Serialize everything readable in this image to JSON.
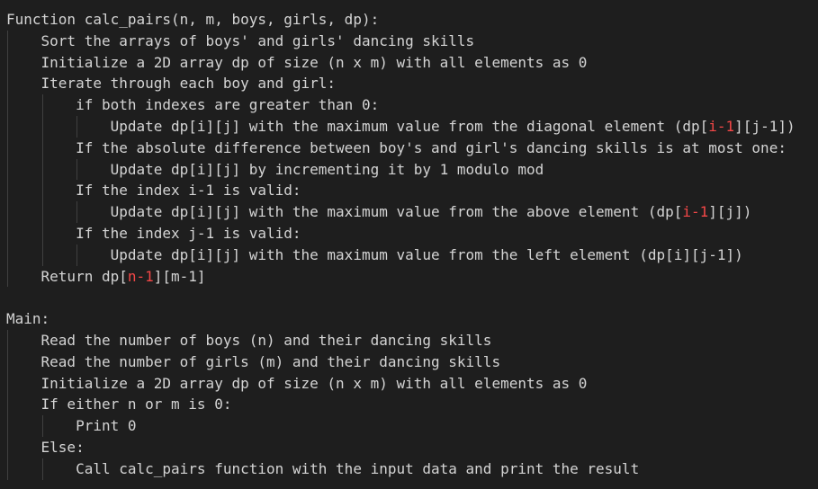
{
  "colors": {
    "background": "#1e1e1e",
    "text": "#d4d4d4",
    "indent_guide": "#404040",
    "error_highlight": "#f44747"
  },
  "lines": [
    {
      "indent": 0,
      "tokens": [
        {
          "t": "Function calc_pairs(n, m, boys, girls, dp):"
        }
      ]
    },
    {
      "indent": 1,
      "tokens": [
        {
          "t": "Sort the arrays of boys' and girls' dancing skills"
        }
      ]
    },
    {
      "indent": 1,
      "tokens": [
        {
          "t": "Initialize a 2D array dp of size (n x m) with all elements as 0"
        }
      ]
    },
    {
      "indent": 1,
      "tokens": [
        {
          "t": "Iterate through each boy and girl:"
        }
      ]
    },
    {
      "indent": 2,
      "tokens": [
        {
          "t": "if both indexes are greater than 0:"
        }
      ]
    },
    {
      "indent": 3,
      "tokens": [
        {
          "t": "Update dp[i][j] with the maximum value from the diagonal element (dp["
        },
        {
          "t": "i-1",
          "c": "red"
        },
        {
          "t": "][j-1])"
        }
      ]
    },
    {
      "indent": 2,
      "tokens": [
        {
          "t": "If the absolute difference between boy's and girl's dancing skills is at most one:"
        }
      ]
    },
    {
      "indent": 3,
      "tokens": [
        {
          "t": "Update dp[i][j] by incrementing it by 1 modulo mod"
        }
      ]
    },
    {
      "indent": 2,
      "tokens": [
        {
          "t": "If the index i-1 is valid:"
        }
      ]
    },
    {
      "indent": 3,
      "tokens": [
        {
          "t": "Update dp[i][j] with the maximum value from the above element (dp["
        },
        {
          "t": "i-1",
          "c": "red"
        },
        {
          "t": "][j])"
        }
      ]
    },
    {
      "indent": 2,
      "tokens": [
        {
          "t": "If the index j-1 is valid:"
        }
      ]
    },
    {
      "indent": 3,
      "tokens": [
        {
          "t": "Update dp[i][j] with the maximum value from the left element (dp[i][j-1])"
        }
      ]
    },
    {
      "indent": 1,
      "tokens": [
        {
          "t": "Return dp["
        },
        {
          "t": "n-1",
          "c": "red"
        },
        {
          "t": "][m-1]"
        }
      ]
    },
    {
      "indent": 0,
      "tokens": [
        {
          "t": ""
        }
      ]
    },
    {
      "indent": 0,
      "tokens": [
        {
          "t": "Main:"
        }
      ]
    },
    {
      "indent": 1,
      "tokens": [
        {
          "t": "Read the number of boys (n) and their dancing skills"
        }
      ]
    },
    {
      "indent": 1,
      "tokens": [
        {
          "t": "Read the number of girls (m) and their dancing skills"
        }
      ]
    },
    {
      "indent": 1,
      "tokens": [
        {
          "t": "Initialize a 2D array dp of size (n x m) with all elements as 0"
        }
      ]
    },
    {
      "indent": 1,
      "tokens": [
        {
          "t": "If either n or m is 0:"
        }
      ]
    },
    {
      "indent": 2,
      "tokens": [
        {
          "t": "Print 0"
        }
      ]
    },
    {
      "indent": 1,
      "tokens": [
        {
          "t": "Else:"
        }
      ]
    },
    {
      "indent": 2,
      "tokens": [
        {
          "t": "Call calc_pairs function with the input data and print the result"
        }
      ]
    }
  ]
}
